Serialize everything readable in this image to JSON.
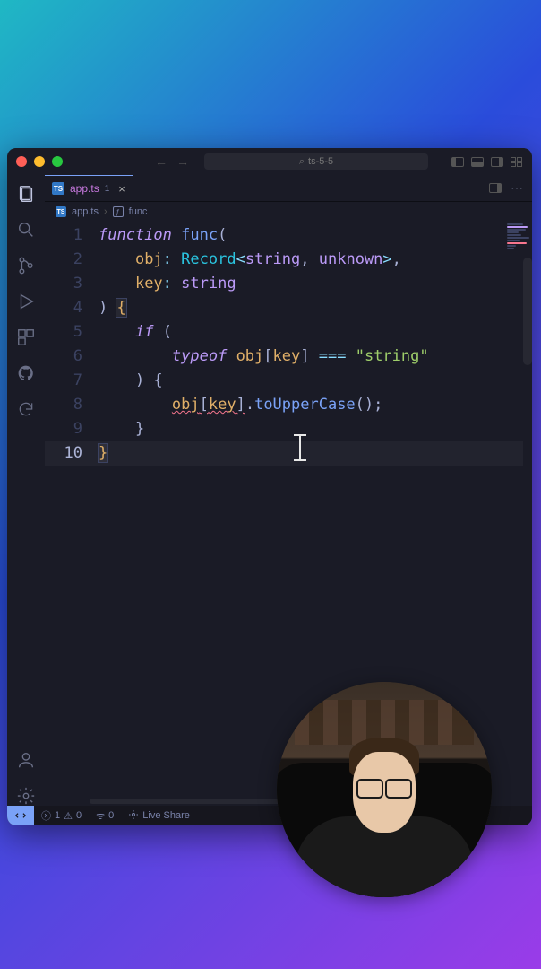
{
  "window": {
    "title": "ts-5-5"
  },
  "tabs": [
    {
      "label": "app.ts",
      "active": true
    }
  ],
  "breadcrumbs": {
    "file": "app.ts",
    "symbol": "func"
  },
  "code": {
    "lines": [
      {
        "num": 1,
        "tokens": [
          [
            "k-func",
            "function"
          ],
          [
            "",
            " "
          ],
          [
            "k-name",
            "func"
          ],
          [
            "k-punc",
            "("
          ]
        ]
      },
      {
        "num": 2,
        "tokens": [
          [
            "",
            "    "
          ],
          [
            "k-param",
            "obj"
          ],
          [
            "k-op",
            ":"
          ],
          [
            "",
            " "
          ],
          [
            "k-type",
            "Record"
          ],
          [
            "k-op",
            "<"
          ],
          [
            "k-typename",
            "string"
          ],
          [
            "k-punc",
            ", "
          ],
          [
            "k-typename",
            "unknown"
          ],
          [
            "k-op",
            ">"
          ],
          [
            "k-punc",
            ","
          ]
        ]
      },
      {
        "num": 3,
        "tokens": [
          [
            "",
            "    "
          ],
          [
            "k-param",
            "key"
          ],
          [
            "k-op",
            ":"
          ],
          [
            "",
            " "
          ],
          [
            "k-typename",
            "string"
          ]
        ]
      },
      {
        "num": 4,
        "tokens": [
          [
            "k-punc",
            ") "
          ],
          [
            "k-brace-hl",
            "{"
          ]
        ]
      },
      {
        "num": 5,
        "tokens": [
          [
            "",
            "    "
          ],
          [
            "k-func",
            "if"
          ],
          [
            "",
            " "
          ],
          [
            "k-punc",
            "("
          ]
        ]
      },
      {
        "num": 6,
        "tokens": [
          [
            "",
            "        "
          ],
          [
            "k-func",
            "typeof"
          ],
          [
            "",
            " "
          ],
          [
            "k-prop",
            "obj"
          ],
          [
            "k-punc",
            "["
          ],
          [
            "k-prop",
            "key"
          ],
          [
            "k-punc",
            "]"
          ],
          [
            "",
            " "
          ],
          [
            "k-op",
            "==="
          ],
          [
            "",
            " "
          ],
          [
            "k-str",
            "\"string\""
          ]
        ]
      },
      {
        "num": 7,
        "tokens": [
          [
            "",
            "    "
          ],
          [
            "k-punc",
            ") {"
          ]
        ]
      },
      {
        "num": 8,
        "tokens": [
          [
            "",
            "        "
          ],
          [
            "k-err k-prop",
            "obj"
          ],
          [
            "k-err k-punc",
            "["
          ],
          [
            "k-err k-prop",
            "key"
          ],
          [
            "k-err k-punc",
            "]"
          ],
          [
            "k-punc",
            "."
          ],
          [
            "k-method",
            "toUpperCase"
          ],
          [
            "k-punc",
            "();"
          ]
        ]
      },
      {
        "num": 9,
        "tokens": [
          [
            "",
            "    "
          ],
          [
            "k-punc",
            "}"
          ]
        ]
      },
      {
        "num": 10,
        "tokens": [
          [
            "k-brace-hl",
            "}"
          ]
        ],
        "current": true
      }
    ]
  },
  "status": {
    "errors": "1",
    "warnings": "0",
    "ports": "0",
    "liveshare": "Live Share"
  }
}
